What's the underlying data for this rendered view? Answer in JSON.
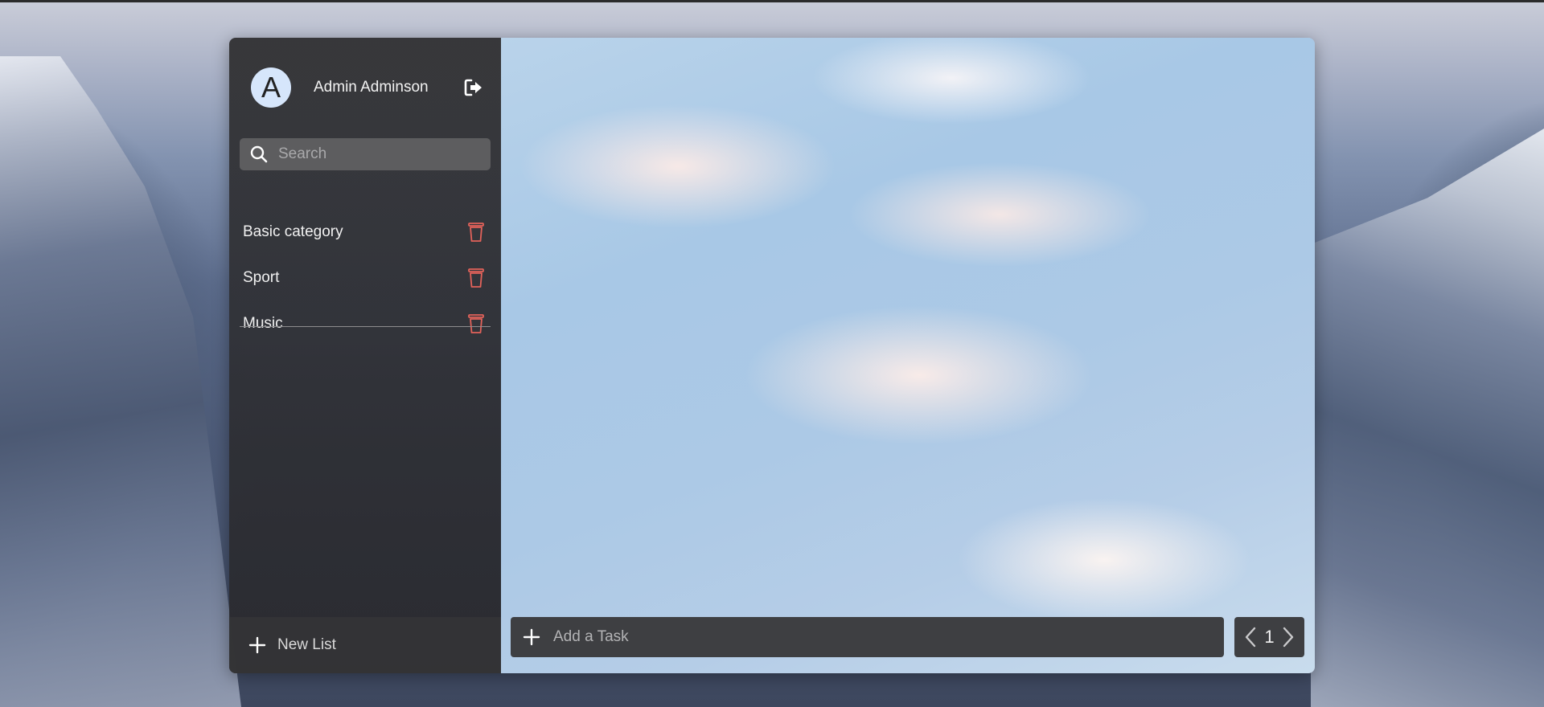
{
  "user": {
    "avatar_letter": "A",
    "name": "Admin Adminson"
  },
  "icons": {
    "logout": "logout-icon",
    "search": "search-icon",
    "trash": "trash-icon",
    "plus": "plus-icon",
    "prev": "chevron-left-icon",
    "next": "chevron-right-icon"
  },
  "search": {
    "placeholder": "Search"
  },
  "categories": [
    {
      "label": "Basic category"
    },
    {
      "label": "Sport"
    },
    {
      "label": "Music"
    }
  ],
  "sidebar_footer": {
    "new_list_label": "New List"
  },
  "main": {
    "add_task_placeholder": "Add a Task",
    "page_number": "1"
  },
  "colors": {
    "trash": "#e2625a",
    "avatar_bg": "#d6e6fb"
  }
}
